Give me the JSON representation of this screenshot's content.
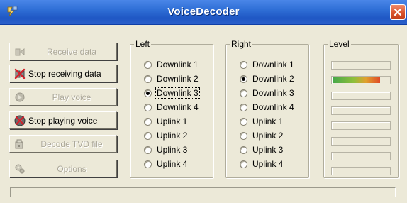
{
  "window": {
    "title": "VoiceDecoder",
    "titlebar_color": "#2f6fd6",
    "close_color": "#d9532e"
  },
  "buttons": [
    {
      "id": "receive",
      "label": "Receive data",
      "enabled": false,
      "icon": "receive-icon"
    },
    {
      "id": "stop-receiving",
      "label": "Stop receiving data",
      "enabled": true,
      "icon": "stop-receive-icon"
    },
    {
      "id": "play",
      "label": "Play voice",
      "enabled": false,
      "icon": "play-voice-icon"
    },
    {
      "id": "stop-playing",
      "label": "Stop playing voice",
      "enabled": true,
      "icon": "stop-play-icon"
    },
    {
      "id": "decode",
      "label": "Decode TVD file",
      "enabled": false,
      "icon": "decode-file-icon"
    },
    {
      "id": "options",
      "label": "Options",
      "enabled": false,
      "icon": "options-icon"
    }
  ],
  "left_group": {
    "label": "Left",
    "options": [
      "Downlink 1",
      "Downlink 2",
      "Downlink 3",
      "Downlink 4",
      "Uplink 1",
      "Uplink 2",
      "Uplink 3",
      "Uplink 4"
    ],
    "selected": "Downlink 3"
  },
  "right_group": {
    "label": "Right",
    "options": [
      "Downlink 1",
      "Downlink 2",
      "Downlink 3",
      "Downlink 4",
      "Uplink 1",
      "Uplink 2",
      "Uplink 3",
      "Uplink 4"
    ],
    "selected": "Downlink 2"
  },
  "level_group": {
    "label": "Level",
    "meters": [
      0,
      0.82,
      0,
      0,
      0,
      0,
      0,
      0
    ],
    "gradient_colors": [
      "#45a84a",
      "#8fbf3a",
      "#e0a02d",
      "#e04a27"
    ]
  },
  "statusbar": {
    "text": ""
  }
}
